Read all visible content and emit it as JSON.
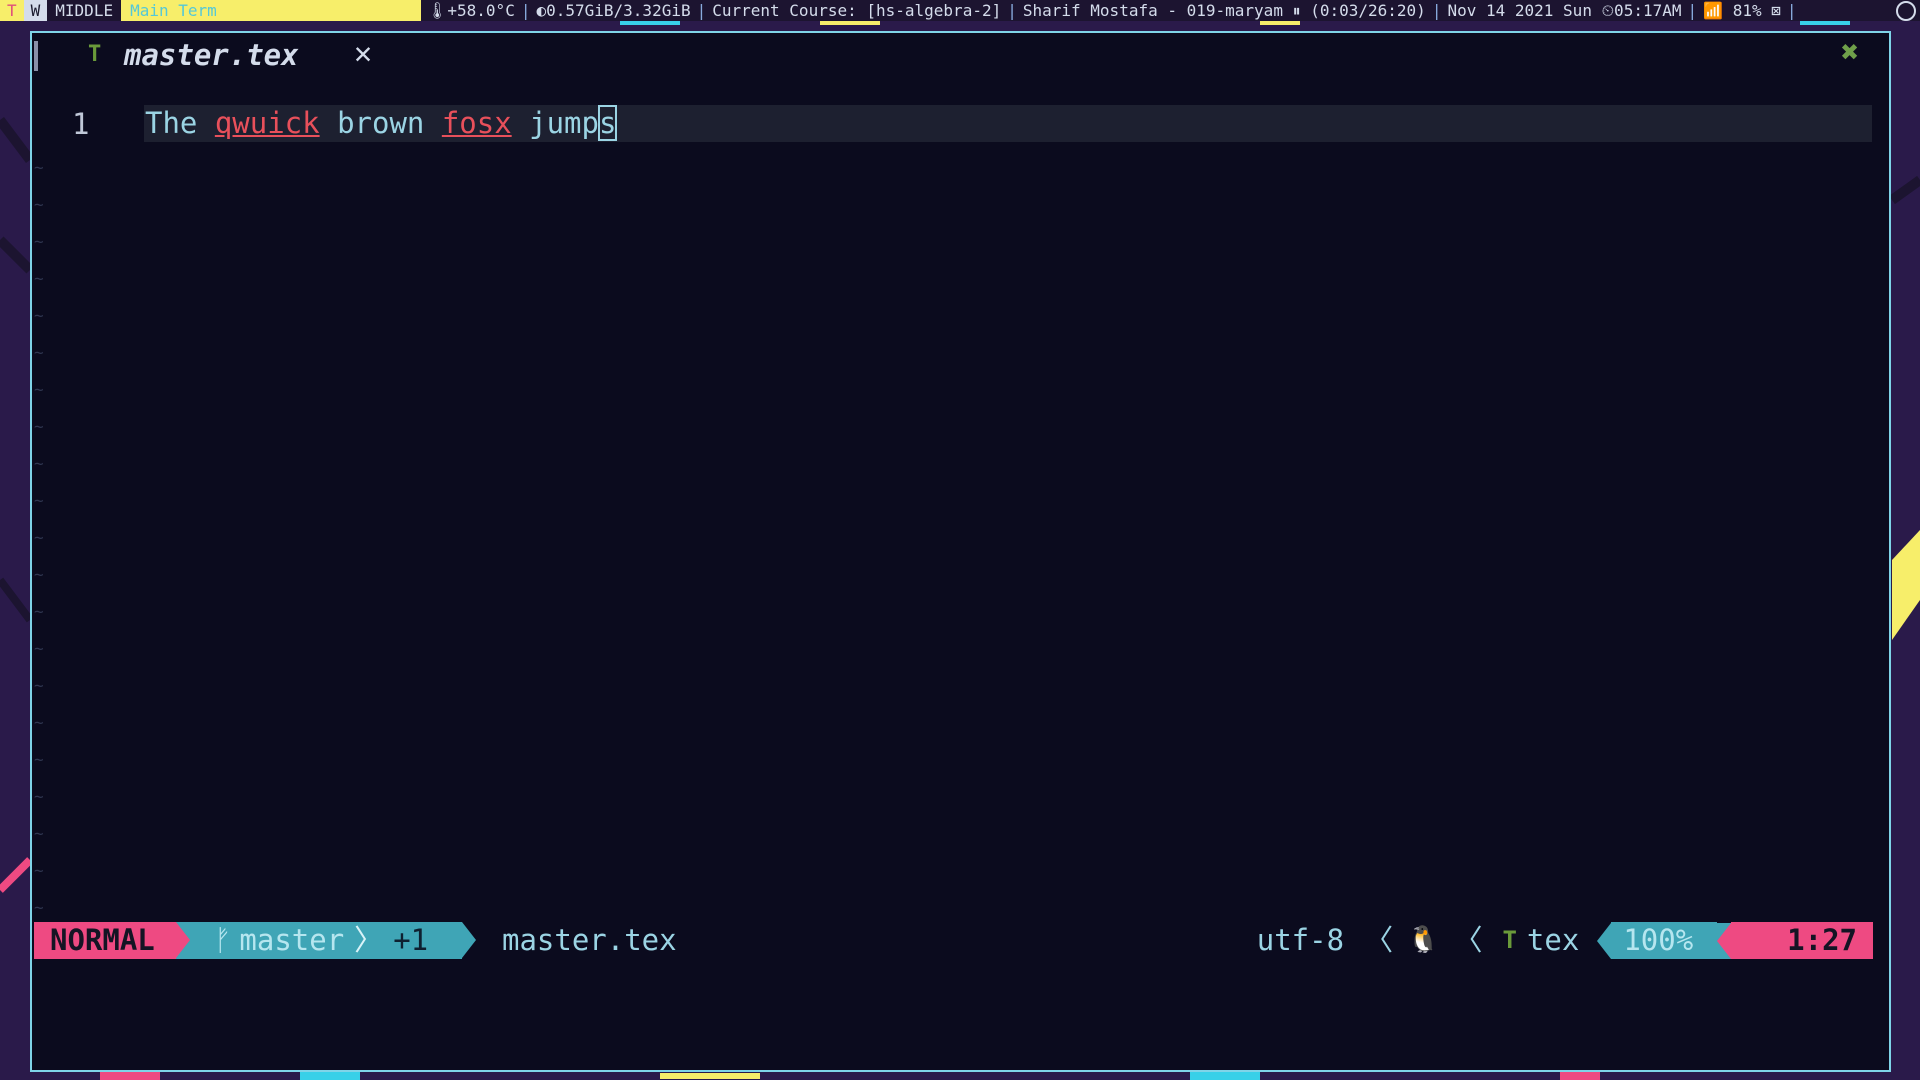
{
  "topbar": {
    "workspace_active": "T",
    "workspace_w": "W",
    "layout": "MIDDLE",
    "window_title": "Main Term",
    "temp": "🌡+58.0°C",
    "memory": "◐0.57GiB/3.32GiB",
    "course": "Current Course: [hs-algebra-2]",
    "session": "Sharif Mostafa - 019-maryam ⏸ (0:03/26:20)",
    "datetime": "Nov 14 2021 Sun ⏲05:17AM",
    "battery": "📶 81% ⊠",
    "separator": "|"
  },
  "tab": {
    "icon": "T",
    "filename": "master.tex",
    "close_glyph": "✕",
    "window_close_glyph": "✖"
  },
  "editor": {
    "line_number": "1",
    "words": {
      "w1": "The ",
      "w2": "qwuick",
      "w3": " brown ",
      "w4": "fosx",
      "w5": " jump",
      "cursor_char": "s"
    },
    "empty_line_marker": "~"
  },
  "statusline": {
    "mode": "NORMAL",
    "branch_icon": "ᚠ",
    "branch": "master",
    "changes": "+1",
    "filename": "master.tex",
    "encoding": "utf-8",
    "os_icon": "🐧",
    "filetype_icon": "T",
    "filetype": "tex",
    "percent": "100%",
    "position": "1:27"
  },
  "colors": {
    "accent_pink": "#ee4a82",
    "accent_teal": "#3fa5b6",
    "spell_error": "#e8505b",
    "border": "#7fd4e8",
    "background": "#0b0b1e"
  }
}
